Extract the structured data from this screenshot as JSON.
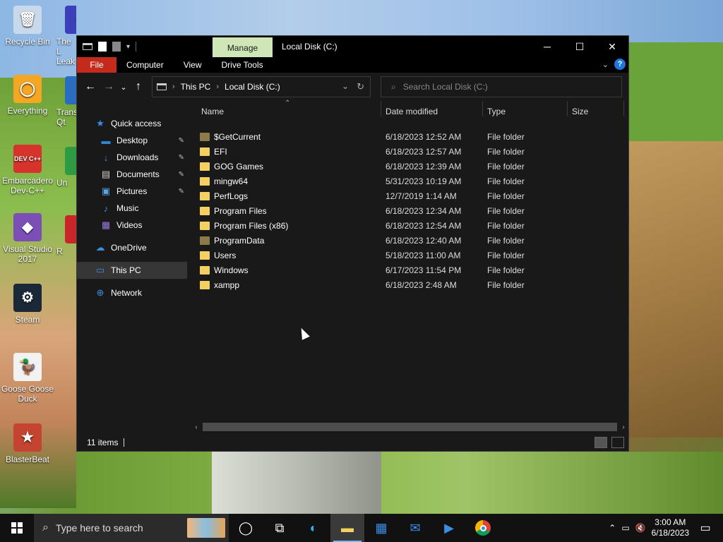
{
  "desktop": {
    "icons": [
      {
        "label": "Recycle Bin",
        "glyph": "🗑",
        "color": "#c7d9ea"
      },
      {
        "label": "Everything",
        "glyph": "◯",
        "color": "#f5a623"
      },
      {
        "label": "Embarcadero Dev-C++",
        "glyph": "DEV C++",
        "color": "#d6332c"
      },
      {
        "label": "Visual Studio 2017",
        "glyph": "◆",
        "color": "#7b4fb6"
      },
      {
        "label": "Steam",
        "glyph": "⚙",
        "color": "#1b2838"
      },
      {
        "label": "Goose Goose Duck",
        "glyph": "🦆",
        "color": "#f2f2f2"
      },
      {
        "label": "BlasterBeat",
        "glyph": "★",
        "color": "#c4442f"
      }
    ],
    "partial_icons": [
      {
        "label": "The L Leak",
        "glyph": "⚘",
        "color": "#3b3fb8"
      },
      {
        "label": "Trans Qt",
        "glyph": "",
        "color": "#2a6cbd"
      },
      {
        "label": "Un",
        "glyph": "",
        "color": "#2e9a44"
      },
      {
        "label": "R",
        "glyph": "",
        "color": "#c9262a"
      }
    ]
  },
  "window": {
    "manage_tab": "Manage",
    "title": "Local Disk (C:)",
    "ribbon_tabs": {
      "file": "File",
      "computer": "Computer",
      "view": "View",
      "drive_tools": "Drive Tools"
    },
    "address": {
      "root": "This PC",
      "current": "Local Disk (C:)"
    },
    "search_placeholder": "Search Local Disk (C:)",
    "sidebar": {
      "quick_access": "Quick access",
      "items": [
        {
          "label": "Desktop",
          "glyph": "▬",
          "color": "#2a8ad4",
          "pinned": true
        },
        {
          "label": "Downloads",
          "glyph": "↓",
          "color": "#3a8ee6",
          "pinned": true
        },
        {
          "label": "Documents",
          "glyph": "▤",
          "color": "#cfcfcf",
          "pinned": true
        },
        {
          "label": "Pictures",
          "glyph": "▣",
          "color": "#5aa5e8",
          "pinned": true
        },
        {
          "label": "Music",
          "glyph": "♪",
          "color": "#3a8ee6",
          "pinned": false
        },
        {
          "label": "Videos",
          "glyph": "▦",
          "color": "#9a7be0",
          "pinned": false
        }
      ],
      "onedrive": "OneDrive",
      "this_pc": "This PC",
      "network": "Network"
    },
    "columns": {
      "name": "Name",
      "date": "Date modified",
      "type": "Type",
      "size": "Size"
    },
    "files": [
      {
        "name": "$GetCurrent",
        "date": "6/18/2023 12:52 AM",
        "type": "File folder",
        "color": "#8c7a4a"
      },
      {
        "name": "EFI",
        "date": "6/18/2023 12:57 AM",
        "type": "File folder",
        "color": "#f4cf62"
      },
      {
        "name": "GOG Games",
        "date": "6/18/2023 12:39 AM",
        "type": "File folder",
        "color": "#f4cf62"
      },
      {
        "name": "mingw64",
        "date": "5/31/2023 10:19 AM",
        "type": "File folder",
        "color": "#f4cf62"
      },
      {
        "name": "PerfLogs",
        "date": "12/7/2019 1:14 AM",
        "type": "File folder",
        "color": "#f4cf62"
      },
      {
        "name": "Program Files",
        "date": "6/18/2023 12:34 AM",
        "type": "File folder",
        "color": "#f4cf62"
      },
      {
        "name": "Program Files (x86)",
        "date": "6/18/2023 12:54 AM",
        "type": "File folder",
        "color": "#f4cf62"
      },
      {
        "name": "ProgramData",
        "date": "6/18/2023 12:40 AM",
        "type": "File folder",
        "color": "#8c7a4a"
      },
      {
        "name": "Users",
        "date": "5/18/2023 11:00 AM",
        "type": "File folder",
        "color": "#f4cf62"
      },
      {
        "name": "Windows",
        "date": "6/17/2023 11:54 PM",
        "type": "File folder",
        "color": "#f4cf62"
      },
      {
        "name": "xampp",
        "date": "6/18/2023 2:48 AM",
        "type": "File folder",
        "color": "#f4cf62"
      }
    ],
    "status": "11 items"
  },
  "taskbar": {
    "search_placeholder": "Type here to search",
    "time": "3:00 AM",
    "date": "6/18/2023"
  }
}
